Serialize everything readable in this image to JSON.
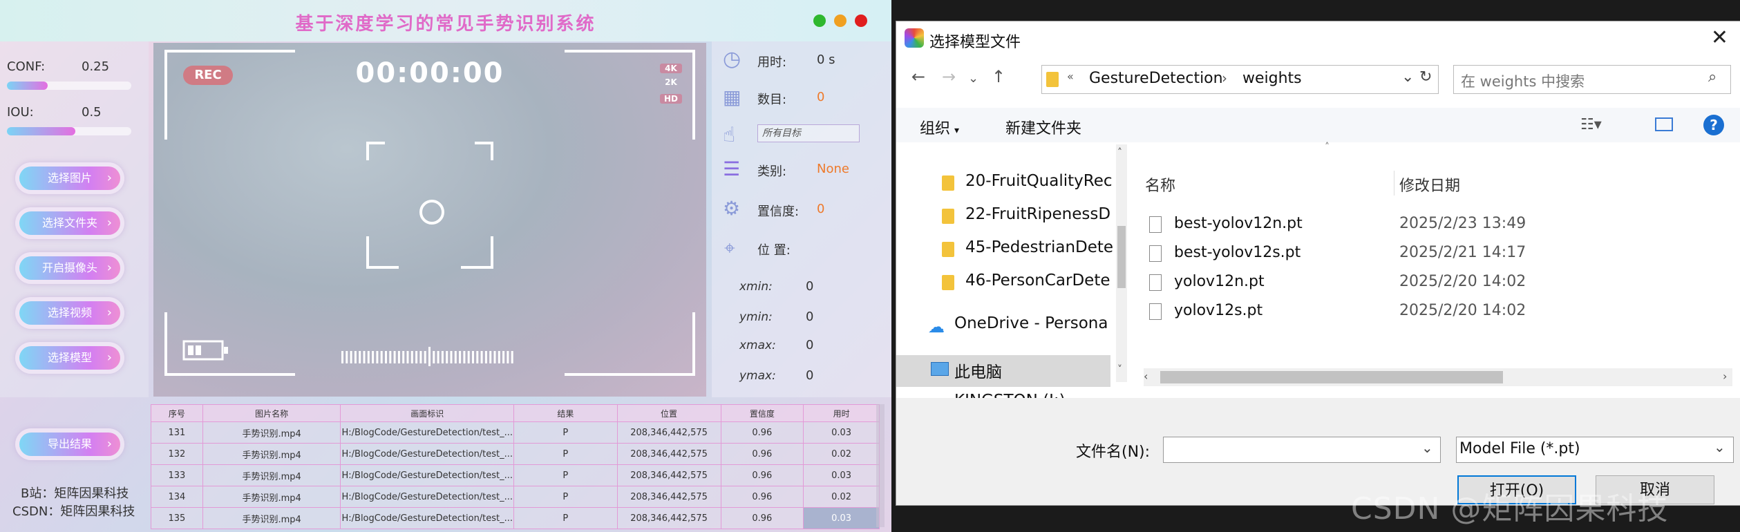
{
  "app": {
    "title": "基于深度学习的常见手势识别系统",
    "window_buttons": {
      "green": "#2eb82e",
      "yellow": "#f0a020",
      "red": "#e01e1e"
    },
    "conf_label": "CONF:",
    "conf_value": "0.25",
    "conf_fraction": 0.33,
    "iou_label": "IOU:",
    "iou_value": "0.5",
    "iou_fraction": 0.55,
    "buttons": [
      "选择图片",
      "选择文件夹",
      "开启摄像头",
      "选择视频",
      "选择模型"
    ],
    "export_label": "导出结果",
    "sig_b": "B站：矩阵因果科技",
    "sig_csdn": "CSDN：矩阵因果科技",
    "video": {
      "rec": "REC",
      "timer": "00:00:00",
      "badges": [
        "4K",
        "2K",
        "HD"
      ]
    },
    "info": {
      "time_label": "用时:",
      "time_value": "0 s",
      "count_label": "数目:",
      "count_value": "0",
      "target_select": "所有目标",
      "class_label": "类别:",
      "class_value": "None",
      "conf_label": "置信度:",
      "conf_value": "0",
      "pos_label": "位 置:",
      "coords": [
        {
          "label": "xmin:",
          "value": "0"
        },
        {
          "label": "ymin:",
          "value": "0"
        },
        {
          "label": "xmax:",
          "value": "0"
        },
        {
          "label": "ymax:",
          "value": "0"
        }
      ]
    },
    "table": {
      "headers": [
        "序号",
        "图片名称",
        "画面标识",
        "结果",
        "位置",
        "置信度",
        "用时"
      ],
      "rows": [
        [
          "131",
          "手势识别.mp4",
          "H:/BlogCode/GestureDetection/test_...",
          "P",
          "208,346,442,575",
          "0.96",
          "0.03"
        ],
        [
          "132",
          "手势识别.mp4",
          "H:/BlogCode/GestureDetection/test_...",
          "P",
          "208,346,442,575",
          "0.96",
          "0.02"
        ],
        [
          "133",
          "手势识别.mp4",
          "H:/BlogCode/GestureDetection/test_...",
          "P",
          "208,346,442,575",
          "0.96",
          "0.03"
        ],
        [
          "134",
          "手势识别.mp4",
          "H:/BlogCode/GestureDetection/test_...",
          "P",
          "208,346,442,575",
          "0.96",
          "0.02"
        ],
        [
          "135",
          "手势识别.mp4",
          "H:/BlogCode/GestureDetection/test_...",
          "P",
          "208,346,442,575",
          "0.96",
          "0.03"
        ]
      ]
    }
  },
  "dialog": {
    "title": "选择模型文件",
    "breadcrumb": [
      "«",
      "GestureDetection",
      "weights"
    ],
    "search_placeholder": "在 weights 中搜索",
    "organize": "组织",
    "new_folder": "新建文件夹",
    "nav_items": [
      "20-FruitQualityRec",
      "22-FruitRipenessD",
      "45-PedestrianDete",
      "46-PersonCarDete",
      "OneDrive - Persona",
      "此电脑",
      "KINGSTON (I:)"
    ],
    "col_name": "名称",
    "col_date": "修改日期",
    "files": [
      {
        "name": "best-yolov12n.pt",
        "date": "2025/2/23 13:49"
      },
      {
        "name": "best-yolov12s.pt",
        "date": "2025/2/21 14:17"
      },
      {
        "name": "yolov12n.pt",
        "date": "2025/2/20 14:02"
      },
      {
        "name": "yolov12s.pt",
        "date": "2025/2/20 14:02"
      }
    ],
    "filename_label": "文件名(N):",
    "filename_value": "",
    "filetype": "Model File (*.pt)",
    "open_label": "打开(O)",
    "cancel_label": "取消"
  },
  "watermark": "CSDN @矩阵因果科技"
}
